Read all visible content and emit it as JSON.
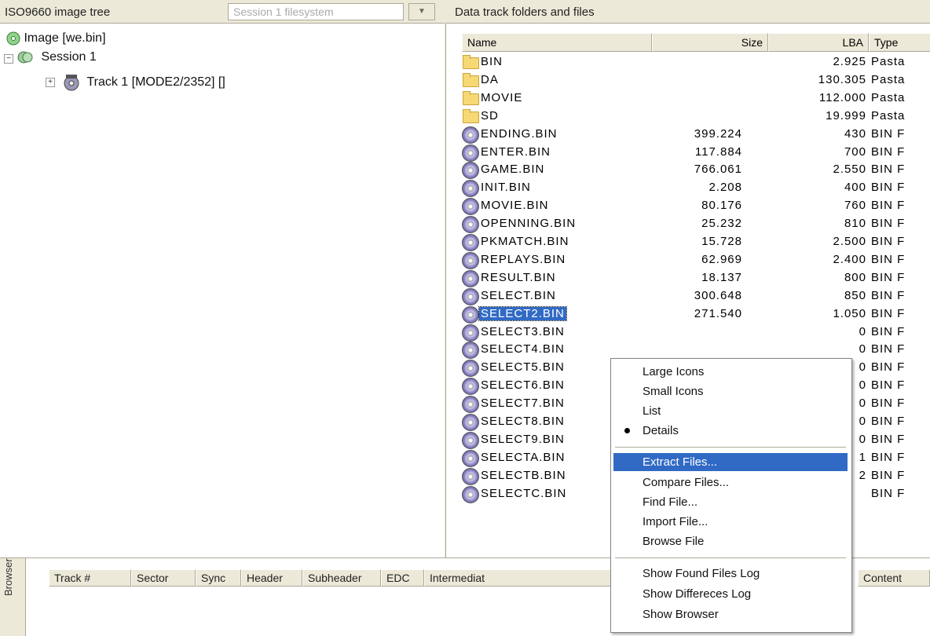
{
  "left_panel": {
    "title": "ISO9660 image tree",
    "session_select_value": "Session 1 filesystem",
    "tree": [
      {
        "label": "Image [we.bin]",
        "icon": "image-disc-icon"
      },
      {
        "label": "Session 1",
        "icon": "session-icon"
      },
      {
        "label": "Track 1 [MODE2/2352] []",
        "icon": "track-icon"
      }
    ]
  },
  "right_panel": {
    "title": "Data track folders and files",
    "columns": [
      "Name",
      "Size",
      "LBA",
      "Type"
    ],
    "files": [
      {
        "name": "BIN",
        "size": "",
        "lba": "2.925",
        "type": "Pasta",
        "kind": "folder"
      },
      {
        "name": "DA",
        "size": "",
        "lba": "130.305",
        "type": "Pasta",
        "kind": "folder"
      },
      {
        "name": "MOVIE",
        "size": "",
        "lba": "112.000",
        "type": "Pasta",
        "kind": "folder"
      },
      {
        "name": "SD",
        "size": "",
        "lba": "19.999",
        "type": "Pasta",
        "kind": "folder"
      },
      {
        "name": "ENDING.BIN",
        "size": "399.224",
        "lba": "430",
        "type": "BIN F",
        "kind": "file"
      },
      {
        "name": "ENTER.BIN",
        "size": "117.884",
        "lba": "700",
        "type": "BIN F",
        "kind": "file"
      },
      {
        "name": "GAME.BIN",
        "size": "766.061",
        "lba": "2.550",
        "type": "BIN F",
        "kind": "file"
      },
      {
        "name": "INIT.BIN",
        "size": "2.208",
        "lba": "400",
        "type": "BIN F",
        "kind": "file"
      },
      {
        "name": "MOVIE.BIN",
        "size": "80.176",
        "lba": "760",
        "type": "BIN F",
        "kind": "file"
      },
      {
        "name": "OPENNING.BIN",
        "size": "25.232",
        "lba": "810",
        "type": "BIN F",
        "kind": "file"
      },
      {
        "name": "PKMATCH.BIN",
        "size": "15.728",
        "lba": "2.500",
        "type": "BIN F",
        "kind": "file"
      },
      {
        "name": "REPLAYS.BIN",
        "size": "62.969",
        "lba": "2.400",
        "type": "BIN F",
        "kind": "file"
      },
      {
        "name": "RESULT.BIN",
        "size": "18.137",
        "lba": "800",
        "type": "BIN F",
        "kind": "file"
      },
      {
        "name": "SELECT.BIN",
        "size": "300.648",
        "lba": "850",
        "type": "BIN F",
        "kind": "file"
      },
      {
        "name": "SELECT2.BIN",
        "size": "271.540",
        "lba": "1.050",
        "type": "BIN F",
        "kind": "file",
        "selected": true
      },
      {
        "name": "SELECT3.BIN",
        "size": "",
        "lba": "0",
        "type": "BIN F",
        "kind": "file"
      },
      {
        "name": "SELECT4.BIN",
        "size": "",
        "lba": "0",
        "type": "BIN F",
        "kind": "file"
      },
      {
        "name": "SELECT5.BIN",
        "size": "",
        "lba": "0",
        "type": "BIN F",
        "kind": "file"
      },
      {
        "name": "SELECT6.BIN",
        "size": "",
        "lba": "0",
        "type": "BIN F",
        "kind": "file"
      },
      {
        "name": "SELECT7.BIN",
        "size": "",
        "lba": "0",
        "type": "BIN F",
        "kind": "file"
      },
      {
        "name": "SELECT8.BIN",
        "size": "",
        "lba": "0",
        "type": "BIN F",
        "kind": "file"
      },
      {
        "name": "SELECT9.BIN",
        "size": "",
        "lba": "0",
        "type": "BIN F",
        "kind": "file"
      },
      {
        "name": "SELECTA.BIN",
        "size": "",
        "lba": "1",
        "type": "BIN F",
        "kind": "file"
      },
      {
        "name": "SELECTB.BIN",
        "size": "",
        "lba": "2",
        "type": "BIN F",
        "kind": "file"
      },
      {
        "name": "SELECTC.BIN",
        "size": "",
        "lba": "",
        "type": "BIN F",
        "kind": "file"
      }
    ]
  },
  "context_menu": {
    "items": [
      {
        "label": "Large Icons"
      },
      {
        "label": "Small Icons"
      },
      {
        "label": "List"
      },
      {
        "label": "Details",
        "checked": true
      },
      {
        "separator": true
      },
      {
        "label": "Extract Files...",
        "highlighted": true
      },
      {
        "label": "Compare Files..."
      },
      {
        "label": "Find File..."
      },
      {
        "label": "Import File..."
      },
      {
        "label": "Browse File"
      },
      {
        "separator": true
      },
      {
        "label": "Show Found Files Log"
      },
      {
        "label": "Show Differeces Log"
      },
      {
        "label": "Show Browser"
      }
    ]
  },
  "browser_panel": {
    "tab_label": "Browser",
    "columns": [
      "Track #",
      "Sector",
      "Sync",
      "Header",
      "Subheader",
      "EDC",
      "Intermediat",
      "Content"
    ]
  },
  "colors": {
    "selection": "#316ac5",
    "window_bg": "#ece9d8",
    "folder": "#f6d874"
  }
}
